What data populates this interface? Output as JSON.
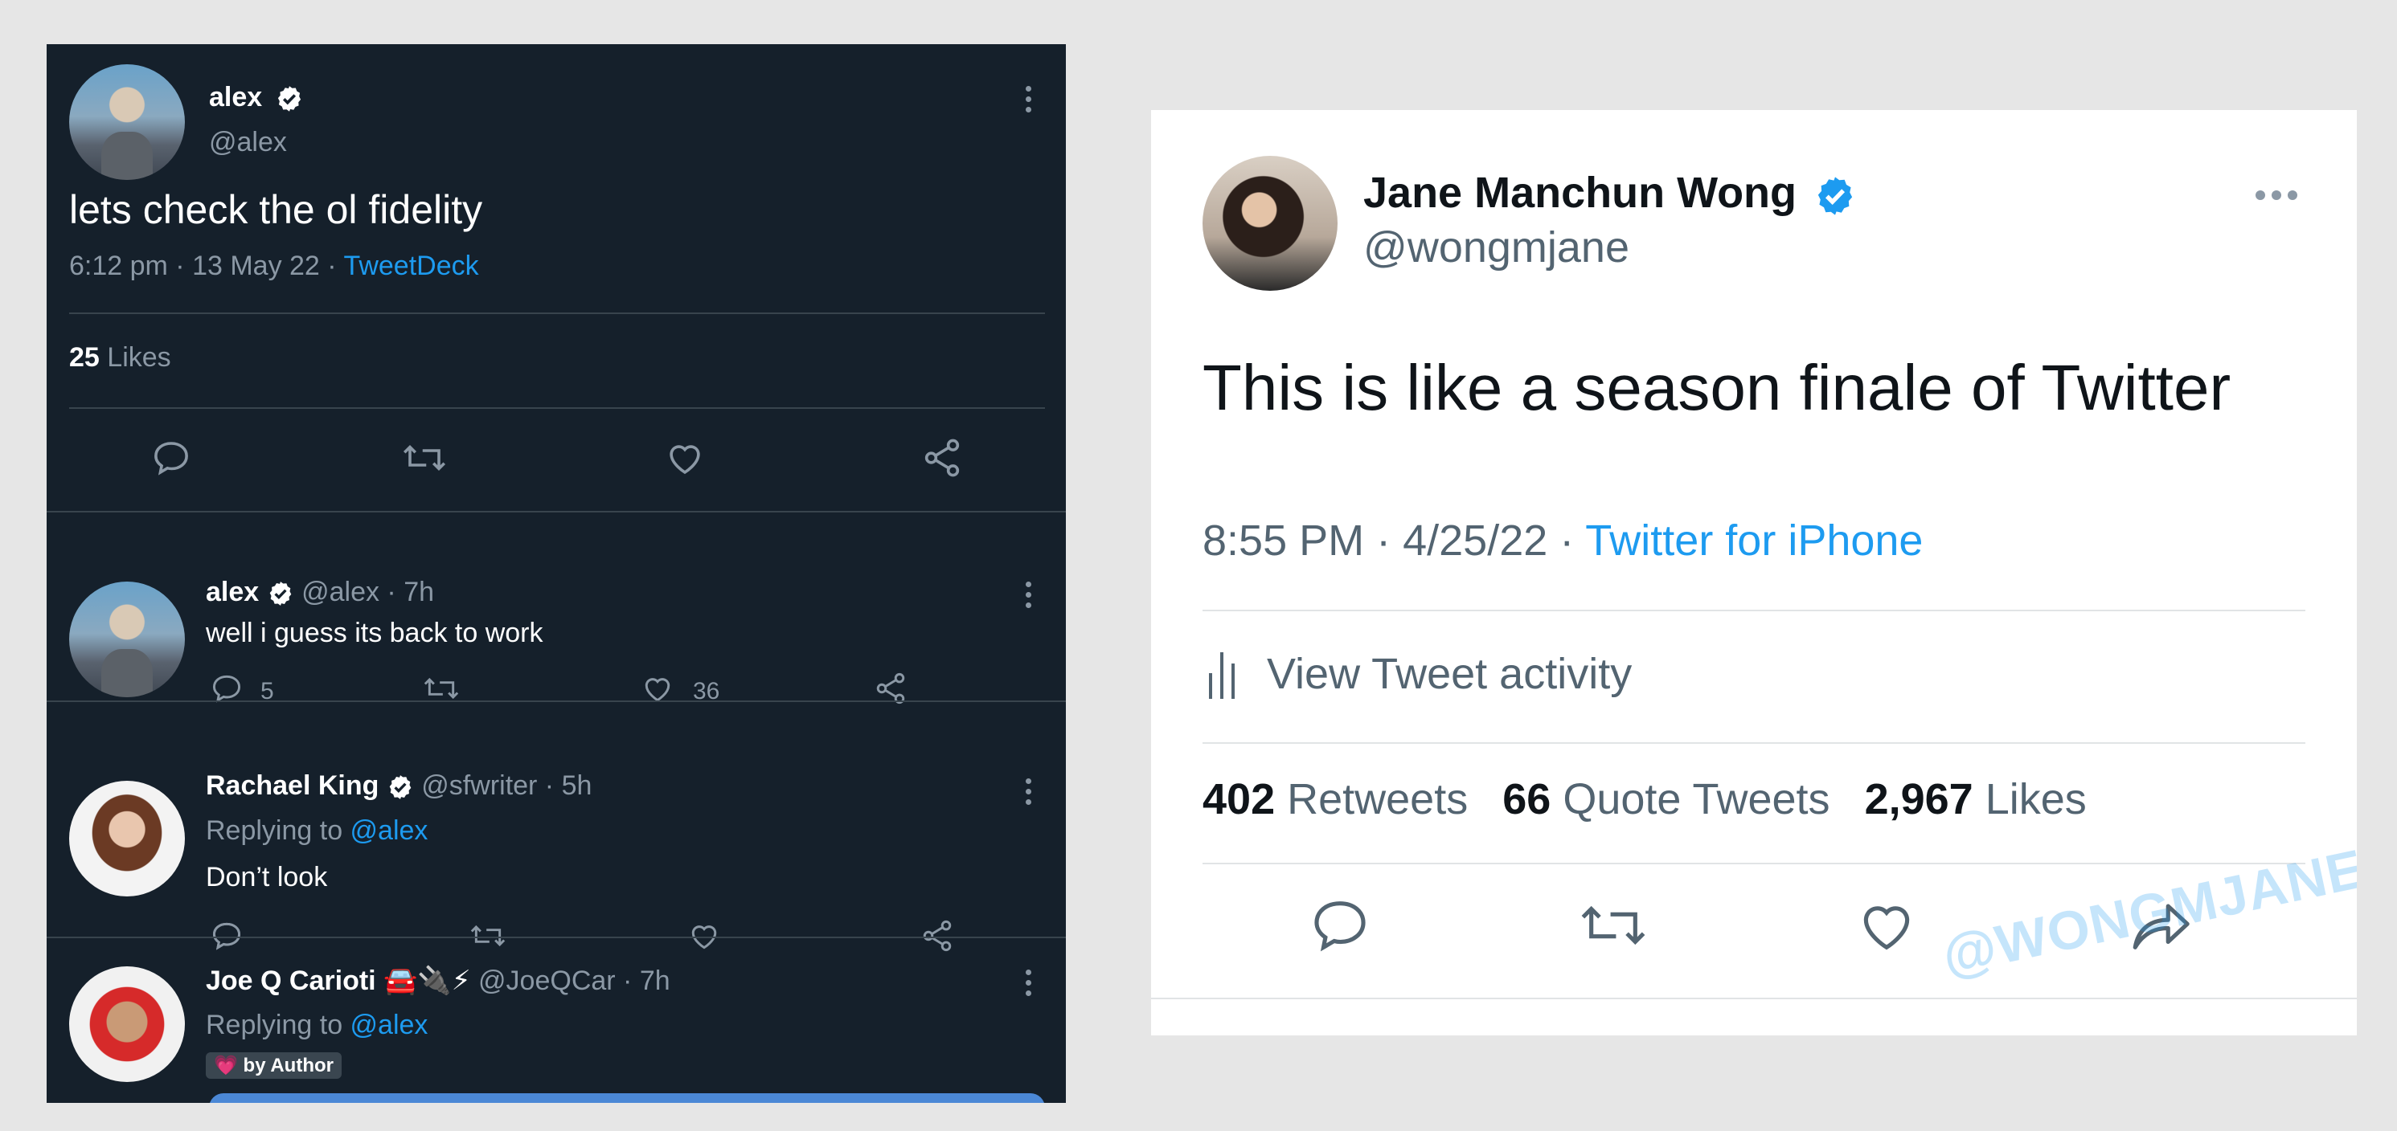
{
  "left": {
    "main_tweet": {
      "name": "alex",
      "handle": "@alex",
      "text": "lets check the ol fidelity",
      "meta_time": "6:12 pm · 13 May 22 · ",
      "meta_source": "TweetDeck",
      "likes_count": "25",
      "likes_label": "Likes"
    },
    "replies": [
      {
        "name": "alex",
        "meta": "@alex · 7h",
        "text": "well i guess its back to work",
        "reply_count": "5",
        "like_count": "36"
      },
      {
        "name": "Rachael King",
        "meta": "@sfwriter · 5h",
        "replying_prefix": "Replying to ",
        "replying_to": "@alex",
        "text": "Don’t look"
      },
      {
        "name": "Joe Q Carioti 🚘🔌⚡",
        "meta": "@JoeQCar · 7h",
        "replying_prefix": "Replying to ",
        "replying_to": "@alex",
        "badge": "💗 by Author"
      }
    ]
  },
  "right": {
    "name": "Jane Manchun Wong",
    "handle": "@wongmjane",
    "text": "This is like a season finale of Twitter",
    "meta_time": "8:55 PM · 4/25/22 · ",
    "meta_source": "Twitter for iPhone",
    "activity_label": "View Tweet activity",
    "stats": [
      {
        "count": "402",
        "label": "Retweets"
      },
      {
        "count": "66",
        "label": "Quote Tweets"
      },
      {
        "count": "2,967",
        "label": "Likes"
      }
    ],
    "watermark": "@WONGMJANE"
  },
  "icons": [
    "verified-icon",
    "more-icon",
    "reply-icon",
    "retweet-icon",
    "like-icon",
    "share-icon",
    "analytics-icon"
  ],
  "colors": {
    "dark_bg": "#15202b",
    "accent": "#1d9bf0",
    "light_bg": "#ffffff",
    "page_bg": "#e6e6e6"
  }
}
